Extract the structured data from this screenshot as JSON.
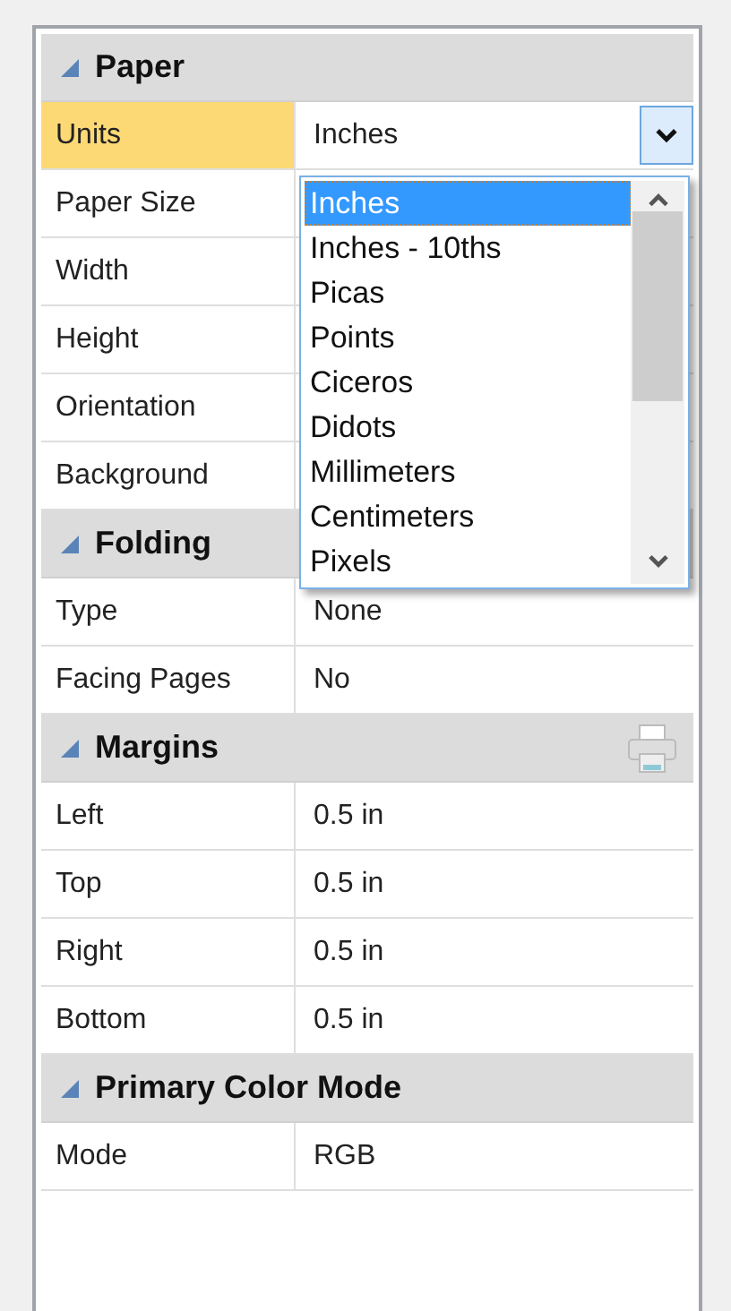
{
  "sections": [
    {
      "title": "Paper",
      "expanded": true,
      "printable": false,
      "rows": [
        {
          "label": "Units",
          "value": "Inches",
          "selected": true,
          "kind": "dropdown",
          "expanded": true,
          "options": [
            {
              "label": "Inches",
              "selected": true
            },
            {
              "label": "Inches - 10ths",
              "selected": false
            },
            {
              "label": "Picas",
              "selected": false
            },
            {
              "label": "Points",
              "selected": false
            },
            {
              "label": "Ciceros",
              "selected": false
            },
            {
              "label": "Didots",
              "selected": false
            },
            {
              "label": "Millimeters",
              "selected": false
            },
            {
              "label": "Centimeters",
              "selected": false
            },
            {
              "label": "Pixels",
              "selected": false
            }
          ]
        },
        {
          "label": "Paper Size",
          "selected": false,
          "kind": "text"
        },
        {
          "label": "Width",
          "selected": false,
          "kind": "text"
        },
        {
          "label": "Height",
          "selected": false,
          "kind": "text"
        },
        {
          "label": "Orientation",
          "selected": false,
          "kind": "text"
        },
        {
          "label": "Background",
          "selected": false,
          "kind": "text"
        }
      ]
    },
    {
      "title": "Folding",
      "expanded": true,
      "printable": false,
      "rows": [
        {
          "label": "Type",
          "value": "None",
          "selected": false,
          "kind": "text"
        },
        {
          "label": "Facing Pages",
          "value": "No",
          "selected": false,
          "kind": "text"
        }
      ]
    },
    {
      "title": "Margins",
      "expanded": true,
      "printable": true,
      "rows": [
        {
          "label": "Left",
          "value": "0.5 in",
          "selected": false,
          "kind": "text"
        },
        {
          "label": "Top",
          "value": "0.5 in",
          "selected": false,
          "kind": "text"
        },
        {
          "label": "Right",
          "value": "0.5 in",
          "selected": false,
          "kind": "text"
        },
        {
          "label": "Bottom",
          "value": "0.5 in",
          "selected": false,
          "kind": "text"
        }
      ]
    },
    {
      "title": "Primary Color Mode",
      "expanded": true,
      "printable": false,
      "rows": [
        {
          "label": "Mode",
          "value": "RGB",
          "selected": false,
          "kind": "text"
        }
      ]
    }
  ]
}
